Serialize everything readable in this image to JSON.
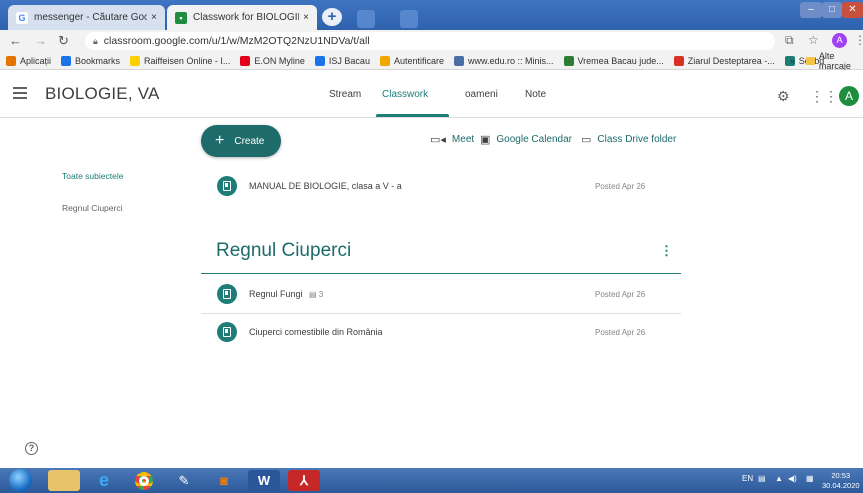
{
  "browser": {
    "tabs": [
      {
        "title": "messenger - Căutare Google",
        "close": "×"
      },
      {
        "title": "Classwork for BIOLOGIE, VA",
        "close": "×"
      }
    ],
    "new_tab": "+",
    "url": "classroom.google.com/u/1/w/MzM2OTQ2NzU1NDVa/t/all",
    "profile_initial": "A",
    "bookmarks": [
      {
        "label": "Aplicații",
        "color": "#e37400"
      },
      {
        "label": "Bookmarks",
        "color": "#1a73e8"
      },
      {
        "label": "Raiffeisen Online - I...",
        "color": "#fdd000"
      },
      {
        "label": "E.ON Myline",
        "color": "#e2001a"
      },
      {
        "label": "ISJ Bacau",
        "color": "#1a73e8"
      },
      {
        "label": "Autentificare",
        "color": "#f2a600"
      },
      {
        "label": "www.edu.ro :: Minis...",
        "color": "#4a6fa5"
      },
      {
        "label": "Vremea Bacau jude...",
        "color": "#2e7d32"
      },
      {
        "label": "Ziarul Desteptarea -...",
        "color": "#d93025"
      },
      {
        "label": "Scribd",
        "color": "#1e7d77"
      }
    ],
    "bookmarks_more": "»",
    "other_bookmarks": "Alte marcaje"
  },
  "classroom": {
    "class_name": "BIOLOGIE, VA",
    "nav": [
      "Stream",
      "Classwork",
      "oameni",
      "Note"
    ],
    "user_initial": "A",
    "create_label": "Create",
    "toolbar": [
      {
        "label": "Meet",
        "icon": "video-icon"
      },
      {
        "label": "Google Calendar",
        "icon": "calendar-icon"
      },
      {
        "label": "Class Drive folder",
        "icon": "folder-icon"
      }
    ],
    "topics": [
      "Toate subiectele",
      "Regnul Ciuperci"
    ],
    "unsorted_items": [
      {
        "title": "MANUAL DE BIOLOGIE, clasa a V - a",
        "posted": "Posted Apr 26"
      }
    ],
    "section": {
      "title": "Regnul Ciuperci",
      "items": [
        {
          "title": "Regnul Fungi",
          "comments": "3",
          "posted": "Posted Apr 26"
        },
        {
          "title": "Ciuperci comestibile din România",
          "posted": "Posted Apr 26"
        }
      ]
    }
  },
  "taskbar": {
    "lang": "EN",
    "time": "20:53",
    "date": "30.04.2020"
  }
}
